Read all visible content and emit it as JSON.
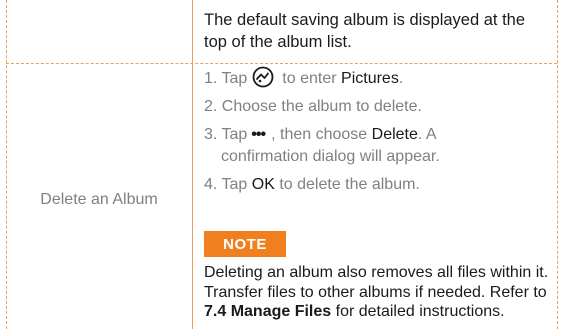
{
  "top_note": {
    "text": "The default saving album is displayed at the top of the album list."
  },
  "row": {
    "label": "Delete an Album",
    "steps": [
      {
        "num": "1.",
        "pre": "Tap",
        "icon": "gallery-icon",
        "post": "to enter",
        "bold": "Pictures",
        "end": "."
      },
      {
        "num": "2.",
        "text": "Choose the album to delete."
      },
      {
        "num": "3.",
        "pre": "Tap",
        "icon": "more-icon",
        "icon_glyph": "•••",
        "mid": ", then choose",
        "bold": "Delete",
        "end": ". A",
        "cont": "confirmation dialog will appear."
      },
      {
        "num": "4.",
        "pre": "Tap",
        "bold": "OK",
        "post": "to delete the album."
      }
    ],
    "note_label": "NOTE",
    "note": {
      "pre": "Deleting an album also removes all files within it. Transfer files to other albums if needed. Refer to ",
      "ref": "7.4 Manage Files",
      "post": " for detailed instructions."
    }
  },
  "colors": {
    "accent": "#f07f1f",
    "border": "#f0a050",
    "text_dark": "#1a1a1a",
    "text_gray": "#808080"
  }
}
